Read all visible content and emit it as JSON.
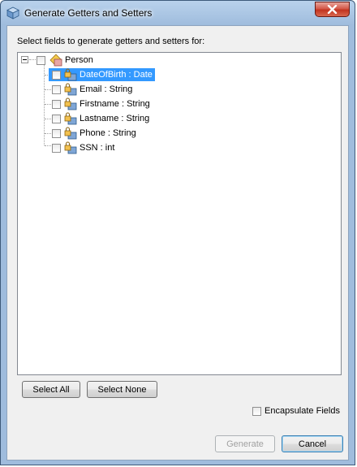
{
  "window": {
    "title": "Generate Getters and Setters"
  },
  "prompt": "Select fields to generate getters and setters for:",
  "tree": {
    "root": {
      "label": "Person",
      "checked": false,
      "expanded": true
    },
    "fields": [
      {
        "label": "DateOfBirth : Date",
        "checked": false,
        "selected": true
      },
      {
        "label": "Email : String",
        "checked": false,
        "selected": false
      },
      {
        "label": "Firstname : String",
        "checked": false,
        "selected": false
      },
      {
        "label": "Lastname : String",
        "checked": false,
        "selected": false
      },
      {
        "label": "Phone : String",
        "checked": false,
        "selected": false
      },
      {
        "label": "SSN : int",
        "checked": false,
        "selected": false
      }
    ]
  },
  "buttons": {
    "select_all": "Select All",
    "select_none": "Select None",
    "generate": "Generate",
    "cancel": "Cancel"
  },
  "encapsulate": {
    "label": "Encapsulate Fields",
    "checked": false
  },
  "colors": {
    "selection": "#3399ff",
    "titlebar": "#9fbcdd",
    "close": "#c2331f"
  }
}
